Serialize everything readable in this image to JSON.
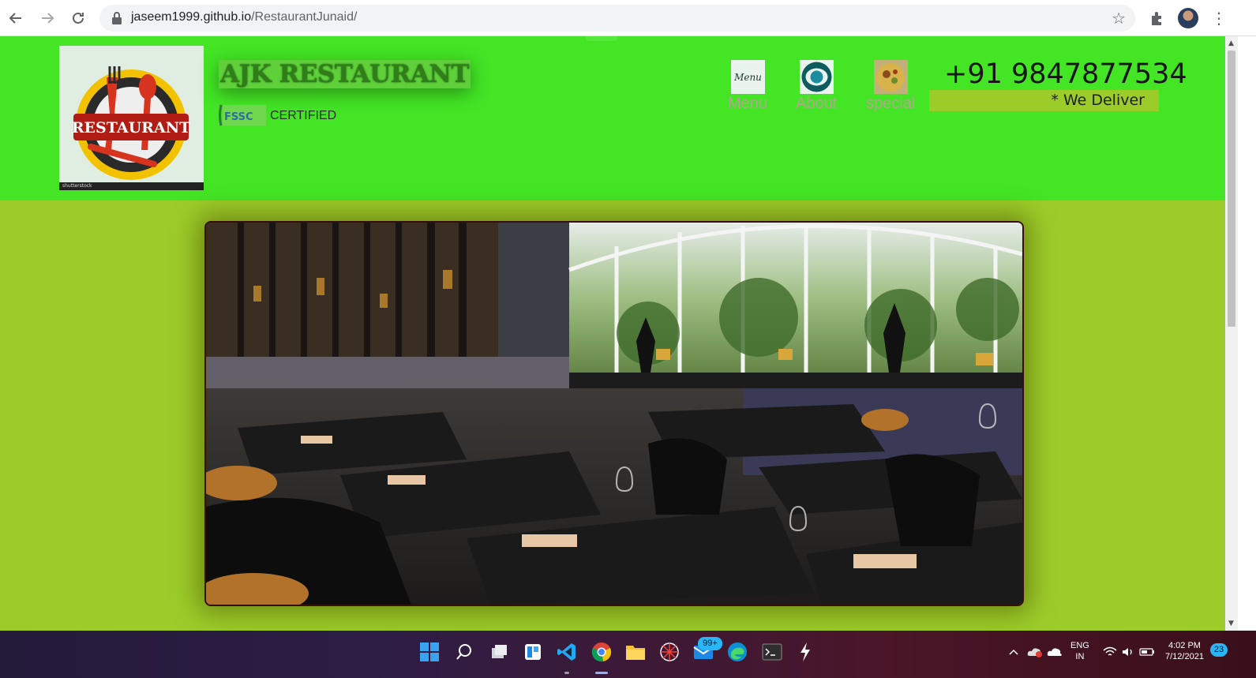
{
  "browser": {
    "url_host": "jaseem1999.github.io",
    "url_path": "/RestaurantJunaid/"
  },
  "header": {
    "logo_text": "RESTAURANT",
    "logo_footer": "shutterstock",
    "brand_name": "AJK RESTAURANT",
    "cert_logo_text": "FSSC",
    "certified_label": "CERTIFIED",
    "nav": [
      {
        "label": "Menu",
        "thumb_text": "Menu"
      },
      {
        "label": "About"
      },
      {
        "label": "special"
      }
    ],
    "phone": "+91 9847877534",
    "deliver_label": "* We Deliver"
  },
  "taskbar": {
    "mail_badge": "99+",
    "lang_top": "ENG",
    "lang_bottom": "IN",
    "time": "4:02 PM",
    "date": "7/12/2021",
    "notification_count": "23"
  },
  "colors": {
    "header_bg": "#43e525",
    "page_bg": "#9ccc2a",
    "nav_label": "#b2a68f"
  }
}
